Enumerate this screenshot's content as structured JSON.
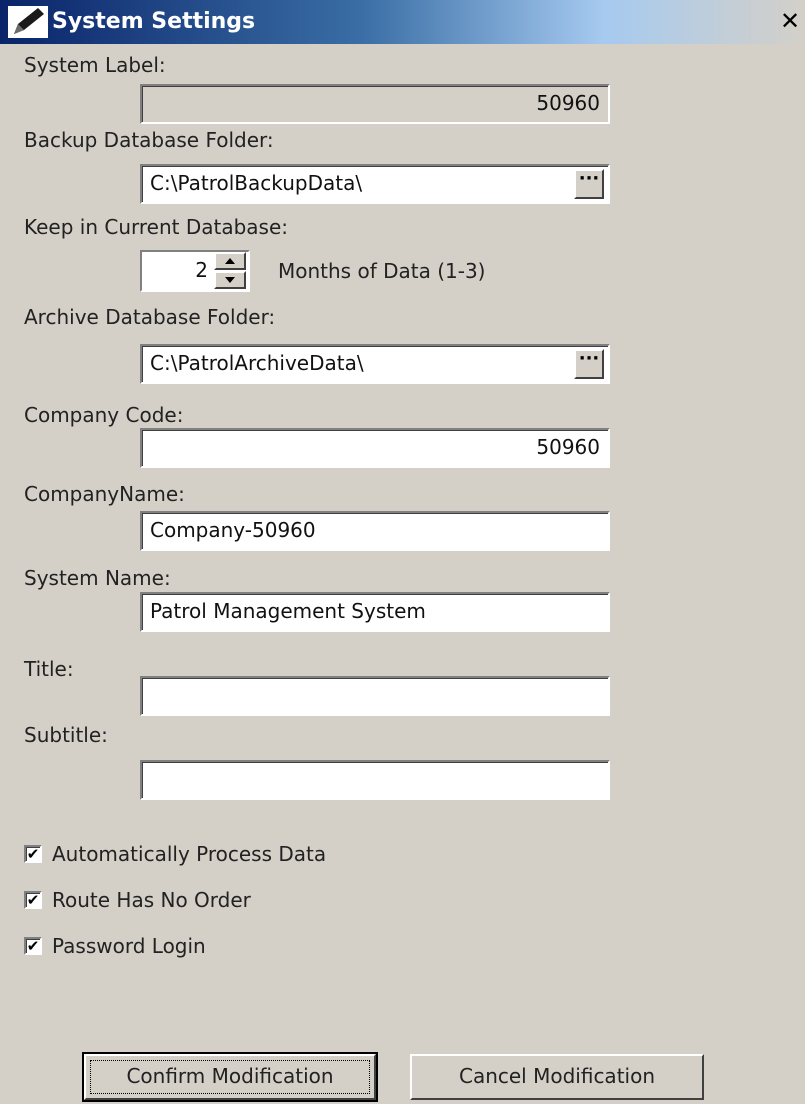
{
  "window": {
    "title": "System Settings",
    "close_glyph": "✕",
    "icon": "pencil-icon"
  },
  "fields": {
    "system_label": {
      "label": "System Label:",
      "value": "50960"
    },
    "backup_folder": {
      "label": "Backup Database Folder:",
      "value": "C:\\PatrolBackupData\\",
      "browse": "···"
    },
    "keep_months": {
      "label": "Keep in Current Database:",
      "value": "2",
      "suffix": "Months of Data (1-3)"
    },
    "archive_folder": {
      "label": "Archive Database Folder:",
      "value": "C:\\PatrolArchiveData\\",
      "browse": "···"
    },
    "company_code": {
      "label": "Company Code:",
      "value": "50960"
    },
    "company_name": {
      "label": "CompanyName:",
      "value": "Company-50960"
    },
    "system_name": {
      "label": "System Name:",
      "value": "Patrol Management System"
    },
    "title": {
      "label": "Title:",
      "value": ""
    },
    "subtitle": {
      "label": "Subtitle:",
      "value": ""
    }
  },
  "options": {
    "auto_process": {
      "label": "Automatically Process Data",
      "checked": true,
      "mark": "✔"
    },
    "route_no_order": {
      "label": "Route Has No Order",
      "checked": true,
      "mark": "✔"
    },
    "password_login": {
      "label": "Password Login",
      "checked": true,
      "mark": "✔"
    }
  },
  "buttons": {
    "confirm": "Confirm Modification",
    "cancel": "Cancel Modification"
  }
}
